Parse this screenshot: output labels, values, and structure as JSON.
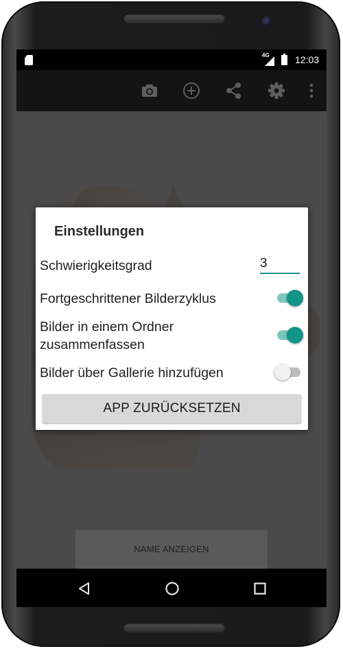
{
  "statusbar": {
    "network": "4G",
    "time": "12:03"
  },
  "toolbar": {
    "icons": [
      "camera-icon",
      "add-circle-icon",
      "share-icon",
      "settings-gear-icon",
      "overflow-menu-icon"
    ]
  },
  "main": {
    "name_button_label": "NAME ANZEIGEN"
  },
  "dialog": {
    "title": "Einstellungen",
    "difficulty_label": "Schwierigkeitsgrad",
    "difficulty_value": "3",
    "advanced_cycle_label": "Fortgeschrittener Bilderzyklus",
    "advanced_cycle_on": true,
    "folder_label_line1": "Bilder in einem Ordner",
    "folder_label_line2": "zusammenfassen",
    "folder_on": true,
    "gallery_label": "Bilder über Gallerie hinzufügen",
    "gallery_on": false,
    "reset_button_label": "APP ZURÜCKSETZEN"
  },
  "navbar": {
    "icons": [
      "back-icon",
      "home-icon",
      "recents-icon"
    ]
  },
  "colors": {
    "accent": "#139488",
    "accent_track": "#7fc6bf",
    "toolbar": "#141414",
    "dim_background": "#4a4a4a"
  }
}
